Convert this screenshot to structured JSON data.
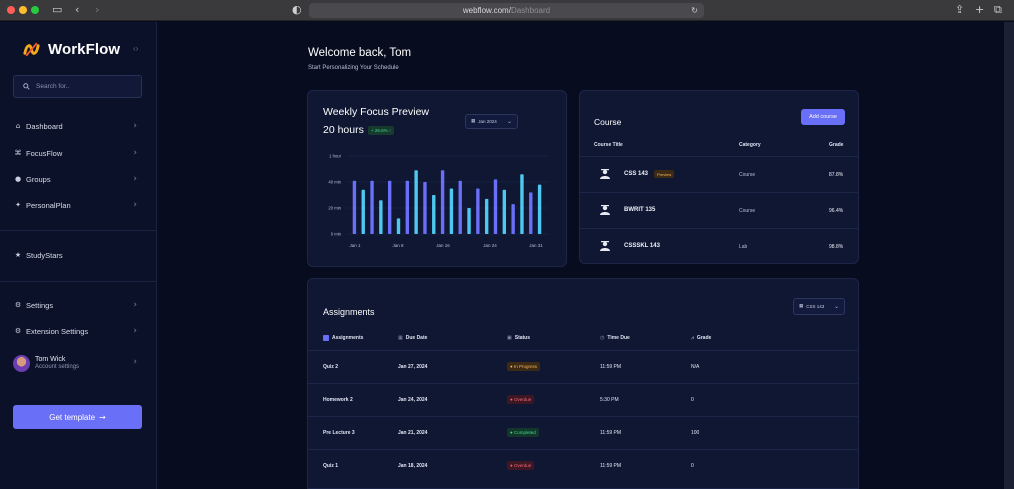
{
  "browser": {
    "url_host": "webflow.com/",
    "url_path": "Dashboard"
  },
  "sidebar": {
    "brand": "WorkFlow",
    "search_placeholder": "Search for..",
    "nav": [
      {
        "label": "Dashboard",
        "icon": "home-icon"
      },
      {
        "label": "FocusFlow",
        "icon": "focus-icon"
      },
      {
        "label": "Groups",
        "icon": "user-icon"
      },
      {
        "label": "PersonalPlan",
        "icon": "plan-icon"
      }
    ],
    "study": {
      "label": "StudyStars",
      "icon": "star-icon"
    },
    "settings": [
      {
        "label": "Settings",
        "icon": "gear-icon"
      },
      {
        "label": "Extension Settings",
        "icon": "gear-icon"
      }
    ],
    "user": {
      "name": "Tom Wick",
      "sub": "Account settings"
    },
    "cta": "Get template"
  },
  "header": {
    "title": "Welcome back, Tom",
    "subtitle": "Start Personalizing Your Schedule"
  },
  "focus": {
    "title": "Weekly Focus Preview",
    "hours": "20 hours",
    "growth": "+ 26.6% ↑",
    "date_select": "Jan 2024"
  },
  "chart_data": {
    "type": "bar",
    "title": "Weekly Focus Preview",
    "y_ticks": [
      "1 hour",
      "40 min",
      "20 min",
      "0 min"
    ],
    "x_ticks": [
      "Jan 1",
      "Jan 8",
      "Jan 16",
      "Jan 24",
      "Jan 31"
    ],
    "ylim": [
      0,
      60
    ],
    "series": [
      {
        "color": "#6a6ff7",
        "values": [
          41,
          41,
          41,
          41,
          41,
          41,
          42,
          41,
          42,
          42,
          41
        ]
      },
      {
        "color": "#4fc8ef",
        "values": [
          34,
          26,
          12,
          27,
          30,
          20,
          27,
          34,
          23,
          46,
          38
        ]
      },
      {
        "color": "#4fc8ef",
        "values": [
          40,
          49,
          49,
          49,
          49,
          49,
          49,
          49,
          49,
          49,
          49
        ]
      }
    ],
    "bars": [
      {
        "c": "p",
        "v": 41
      },
      {
        "c": "b",
        "v": 34
      },
      {
        "c": "p",
        "v": 41
      },
      {
        "c": "b",
        "v": 26
      },
      {
        "c": "p",
        "v": 41
      },
      {
        "c": "b",
        "v": 12
      },
      {
        "c": "p",
        "v": 41
      },
      {
        "c": "b",
        "v": 49
      },
      {
        "c": "p",
        "v": 40
      },
      {
        "c": "b",
        "v": 30
      },
      {
        "c": "p",
        "v": 49
      },
      {
        "c": "b",
        "v": 35
      },
      {
        "c": "p",
        "v": 41
      },
      {
        "c": "b",
        "v": 20
      },
      {
        "c": "p",
        "v": 35
      },
      {
        "c": "b",
        "v": 27
      },
      {
        "c": "p",
        "v": 42
      },
      {
        "c": "b",
        "v": 34
      },
      {
        "c": "p",
        "v": 23
      },
      {
        "c": "b",
        "v": 46
      },
      {
        "c": "p",
        "v": 32
      },
      {
        "c": "b",
        "v": 38
      }
    ]
  },
  "course": {
    "title": "Course",
    "add_button": "Add course",
    "columns": [
      "Course Title",
      "Category",
      "Grade"
    ],
    "rows": [
      {
        "title": "CSS 143",
        "badge": "Preview",
        "category": "Course",
        "grade": "87.8%"
      },
      {
        "title": "BWRIT 135",
        "badge": "",
        "category": "Course",
        "grade": "96.4%"
      },
      {
        "title": "CSSSKL 143",
        "badge": "",
        "category": "Lab",
        "grade": "98.8%"
      }
    ]
  },
  "assignments": {
    "title": "Assignments",
    "class_select": "CSS 143",
    "columns": [
      "Assignments",
      "Due Date",
      "Status",
      "Time Due",
      "Grade"
    ],
    "rows": [
      {
        "name": "Quiz 2",
        "due": "Jan 27, 2024",
        "status": "In Progress",
        "status_kind": "progress",
        "time": "11:59 PM",
        "grade": "N/A"
      },
      {
        "name": "Homework 2",
        "due": "Jan 24, 2024",
        "status": "Overdue",
        "status_kind": "overdue",
        "time": "5:30 PM",
        "grade": "0"
      },
      {
        "name": "Pre Lecture 3",
        "due": "Jan 21, 2024",
        "status": "Completed",
        "status_kind": "complete",
        "time": "11:59 PM",
        "grade": "100"
      },
      {
        "name": "Quiz 1",
        "due": "Jan 18, 2024",
        "status": "Overdue",
        "status_kind": "overdue",
        "time": "11:59 PM",
        "grade": "0"
      }
    ]
  }
}
